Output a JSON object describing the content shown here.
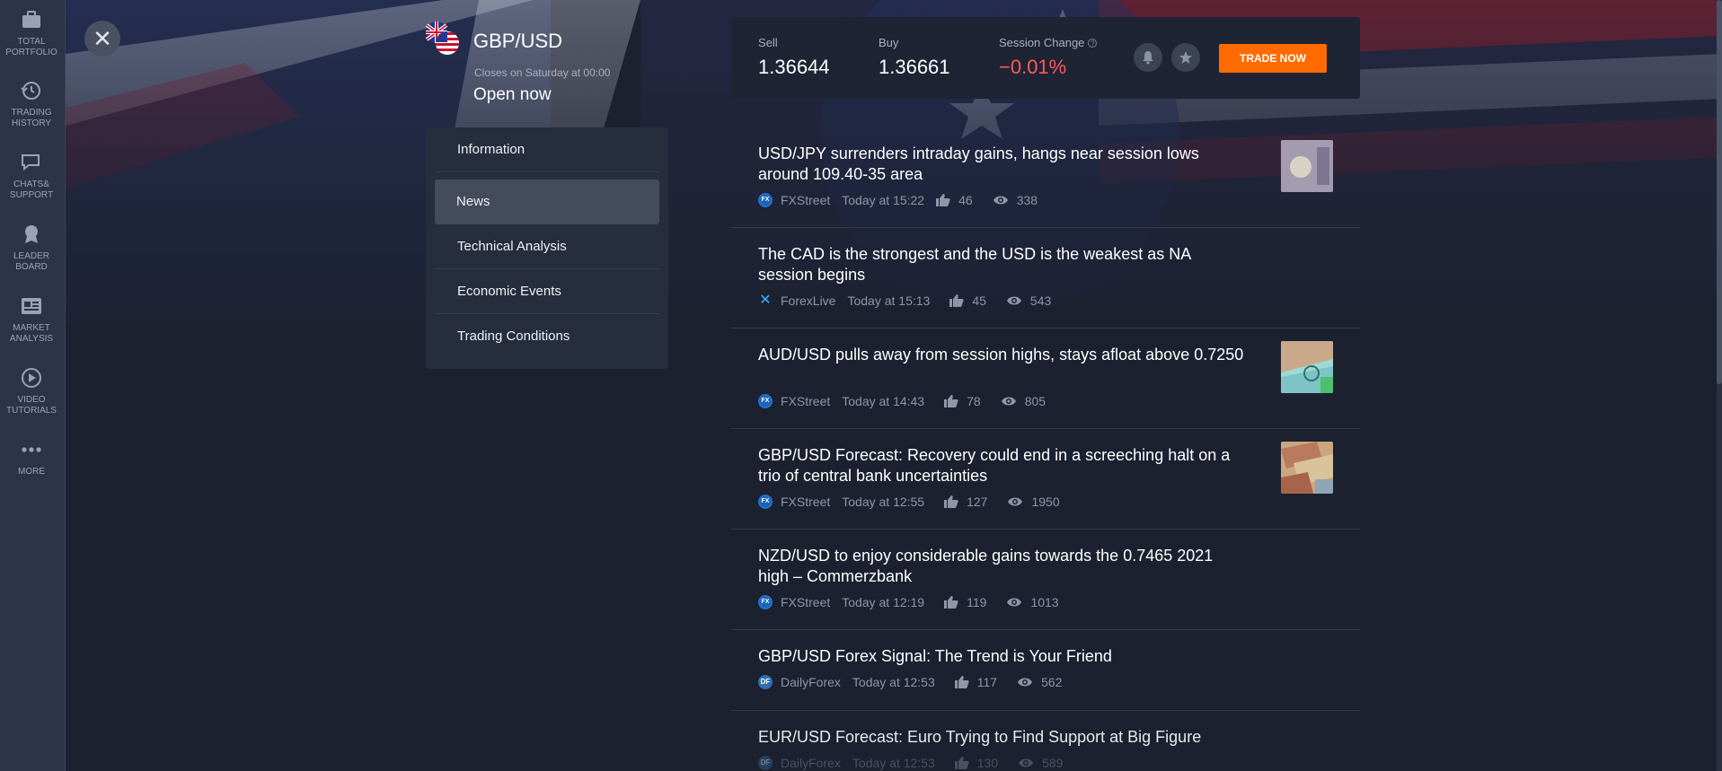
{
  "sidebar": {
    "items": [
      {
        "label": "TOTAL\nPORTFOLIO",
        "icon": "briefcase-icon"
      },
      {
        "label": "TRADING\nHISTORY",
        "icon": "history-icon"
      },
      {
        "label": "CHATS&\nSUPPORT",
        "icon": "chat-icon"
      },
      {
        "label": "LEADER\nBOARD",
        "icon": "award-icon"
      },
      {
        "label": "MARKET\nANALYSIS",
        "icon": "newspaper-icon"
      },
      {
        "label": "VIDEO\nTUTORIALS",
        "icon": "play-icon"
      },
      {
        "label": "MORE",
        "icon": "more-icon"
      }
    ]
  },
  "asset": {
    "name": "GBP/USD",
    "closes": "Closes on Saturday at 00:00",
    "status": "Open now"
  },
  "menu": {
    "items": [
      "Information",
      "News",
      "Technical Analysis",
      "Economic Events",
      "Trading Conditions"
    ],
    "active": "News"
  },
  "quote": {
    "sell_label": "Sell",
    "sell_value": "1.36644",
    "buy_label": "Buy",
    "buy_value": "1.36661",
    "change_label": "Session Change",
    "change_value": "−0.01%",
    "trade_label": "TRADE NOW"
  },
  "news": [
    {
      "title": "USD/JPY surrenders intraday gains, hangs near session lows around 109.40-35 area",
      "source": "FXStreet",
      "time": "Today at 15:22",
      "likes": "46",
      "views": "338",
      "thumb": true
    },
    {
      "title": "The CAD is the strongest and the USD is the weakest as NA session begins",
      "source": "ForexLive",
      "time": "Today at 15:13",
      "likes": "45",
      "views": "543",
      "thumb": false
    },
    {
      "title": "AUD/USD pulls away from session highs, stays afloat above 0.7250",
      "source": "FXStreet",
      "time": "Today at 14:43",
      "likes": "78",
      "views": "805",
      "thumb": true
    },
    {
      "title": "GBP/USD Forecast: Recovery could end in a screeching halt on a trio of central bank uncertainties",
      "source": "FXStreet",
      "time": "Today at 12:55",
      "likes": "127",
      "views": "1950",
      "thumb": true
    },
    {
      "title": "NZD/USD to enjoy considerable gains towards the 0.7465 2021 high – Commerzbank",
      "source": "FXStreet",
      "time": "Today at 12:19",
      "likes": "119",
      "views": "1013",
      "thumb": false
    },
    {
      "title": "GBP/USD Forex Signal: The Trend is Your Friend",
      "source": "DailyForex",
      "time": "Today at 12:53",
      "likes": "117",
      "views": "562",
      "thumb": false
    },
    {
      "title": "EUR/USD Forecast: Euro Trying to Find Support at Big Figure",
      "source": "DailyForex",
      "time": "Today at 12:53",
      "likes": "130",
      "views": "589",
      "thumb": false
    }
  ],
  "colors": {
    "accent": "#ff6b00",
    "negative": "#ff5a5a",
    "background": "#1c2130"
  }
}
